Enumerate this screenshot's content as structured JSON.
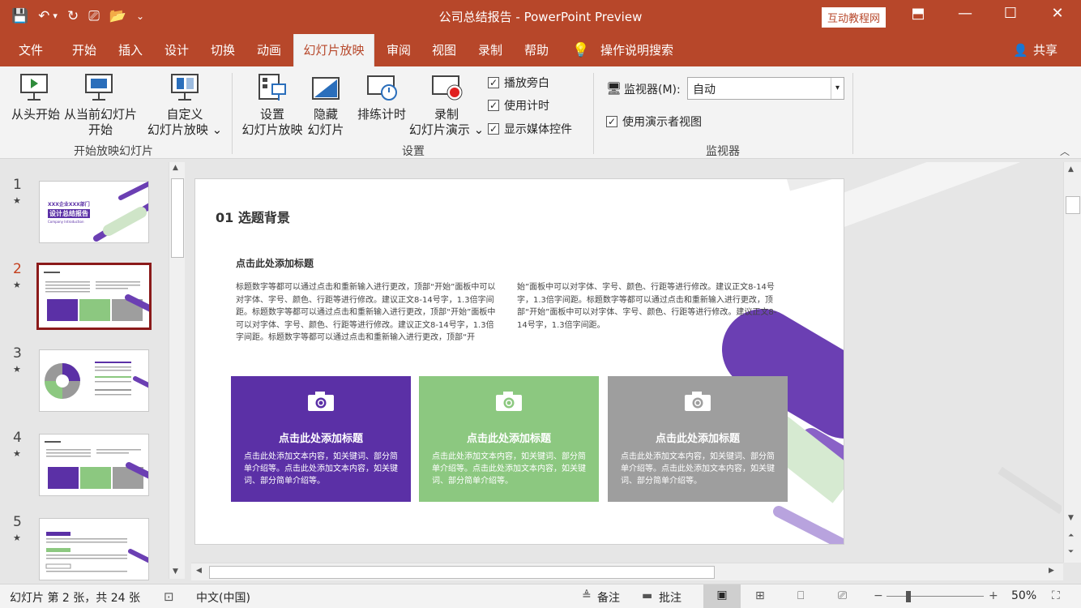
{
  "window": {
    "title": "公司总结报告  -  PowerPoint Preview",
    "badge": "互动教程网"
  },
  "qat": {
    "save": "💾",
    "undo": "↶",
    "undo_dd": "▾",
    "redo": "↻",
    "present": "⎚",
    "open": "📂",
    "more": "⌄"
  },
  "win": {
    "ribbon_opts": "⬒",
    "minimize": "—",
    "maximize": "☐",
    "close": "✕"
  },
  "tabs": [
    "文件",
    "开始",
    "插入",
    "设计",
    "切换",
    "动画",
    "幻灯片放映",
    "审阅",
    "视图",
    "录制",
    "帮助",
    "操作说明搜索"
  ],
  "share": "共享",
  "ribbon": {
    "from_start": "从头开始",
    "from_current_1": "从当前幻灯片",
    "from_current_2": "开始",
    "custom_1": "自定义",
    "custom_2": "幻灯片放映 ⌄",
    "group1": "开始放映幻灯片",
    "setup_1": "设置",
    "setup_2": "幻灯片放映",
    "hide_1": "隐藏",
    "hide_2": "幻灯片",
    "rehearse": "排练计时",
    "record_1": "录制",
    "record_2": "幻灯片演示 ⌄",
    "chk_narration": "播放旁白",
    "chk_timing": "使用计时",
    "chk_media": "显示媒体控件",
    "group2": "设置",
    "monitor_label": "监视器(M):",
    "monitor_value": "自动",
    "chk_presenter": "使用演示者视图",
    "group3": "监视器"
  },
  "thumbs": [
    {
      "num": "1",
      "title": "XXX企业XXX部门",
      "sub": "设计总结报告",
      "small": "Company Introduction"
    },
    {
      "num": "2"
    },
    {
      "num": "3"
    },
    {
      "num": "4"
    },
    {
      "num": "5"
    }
  ],
  "slide": {
    "heading": "01 选题背景",
    "subheading": "点击此处添加标题",
    "body_left": "标题数字等都可以通过点击和重新输入进行更改，顶部“开始”面板中可以对字体、字号、颜色、行距等进行修改。建议正文8-14号字，1.3倍字间距。标题数字等都可以通过点击和重新输入进行更改，顶部“开始”面板中可以对字体、字号、颜色、行距等进行修改。建议正文8-14号字，1.3倍字间距。标题数字等都可以通过点击和重新输入进行更改，顶部“开",
    "body_right": "始”面板中可以对字体、字号、颜色、行距等进行修改。建议正文8-14号字，1.3倍字间距。标题数字等都可以通过点击和重新输入进行更改，顶部“开始”面板中可以对字体、字号、颜色、行距等进行修改。建议正文8-14号字，1.3倍字间距。",
    "cards": [
      {
        "title": "点击此处添加标题",
        "text": "点击此处添加文本内容，如关键词、部分简单介绍等。点击此处添加文本内容，如关键词、部分简单介绍等。",
        "color": "#5b30a6"
      },
      {
        "title": "点击此处添加标题",
        "text": "点击此处添加文本内容，如关键词、部分简单介绍等。点击此处添加文本内容，如关键词、部分简单介绍等。",
        "color": "#8cc880"
      },
      {
        "title": "点击此处添加标题",
        "text": "点击此处添加文本内容，如关键词、部分简单介绍等。点击此处添加文本内容，如关键词、部分简单介绍等。",
        "color": "#9e9e9e"
      }
    ]
  },
  "status": {
    "slide_info": "幻灯片 第 2 张，共 24 张",
    "lang": "中文(中国)",
    "notes": "备注",
    "comments": "批注",
    "zoom": "50%"
  },
  "colors": {
    "accent": "#b7472a",
    "purple": "#5b30a6",
    "green": "#8cc880",
    "gray": "#9e9e9e"
  }
}
